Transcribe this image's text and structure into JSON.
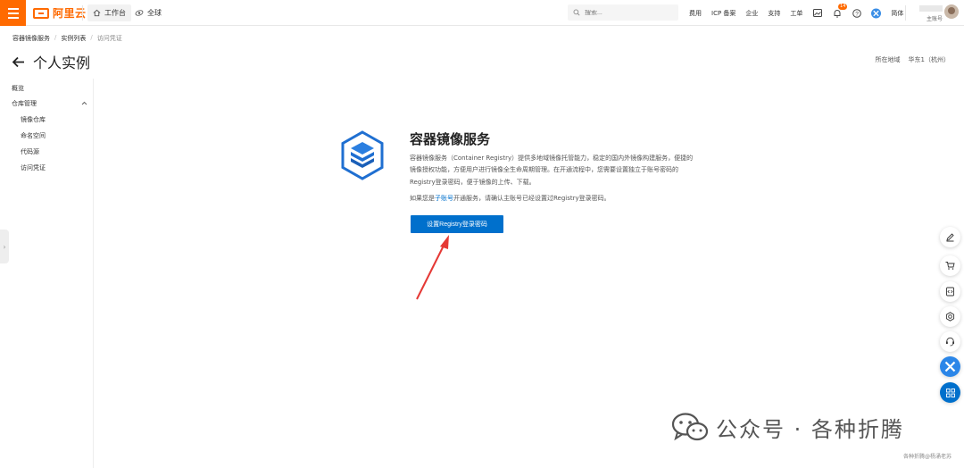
{
  "header": {
    "brand": "阿里云",
    "workbench_label": "工作台",
    "region_label": "全球",
    "search_placeholder": "搜索...",
    "links": [
      "费用",
      "ICP 备案",
      "企业",
      "支持",
      "工单"
    ],
    "notification_count": "14",
    "language_label": "简体",
    "account_role": "主账号"
  },
  "breadcrumb": [
    "容器镜像服务",
    "实例列表",
    "访问凭证"
  ],
  "page": {
    "title": "个人实例",
    "region_label": "所在地域",
    "region_value": "华东1（杭州）"
  },
  "sidebar": {
    "overview": "概览",
    "repo_management": "仓库管理",
    "items": [
      "镜像仓库",
      "命名空间",
      "代码源",
      "访问凭证"
    ]
  },
  "service": {
    "title": "容器镜像服务",
    "description": "容器镜像服务（Container Registry）提供多地域镜像托管能力，稳定的国内外镜像构建服务，便捷的镜像授权功能，方便用户进行镜像全生命周期管理。在开通流程中，您需要设置独立于账号密码的Registry登录密码，便于镜像的上传、下载。",
    "note_prefix": "如果您是",
    "note_link": "子账号",
    "note_suffix": "开通服务，请确认主账号已经设置过Registry登录密码。",
    "button_label": "设置Registry登录密码"
  },
  "floating_tools": [
    "edit-icon",
    "cart-icon",
    "code-icon",
    "settings-icon",
    "support-icon",
    "pinwheel-icon",
    "apps-icon"
  ],
  "watermark": {
    "text": "公众号 · 各种折腾",
    "credit": "各种折腾@杨涌老苏"
  },
  "colors": {
    "brand_orange": "#ff6a00",
    "primary_blue": "#0070cc",
    "annotation_red": "#e53935"
  }
}
